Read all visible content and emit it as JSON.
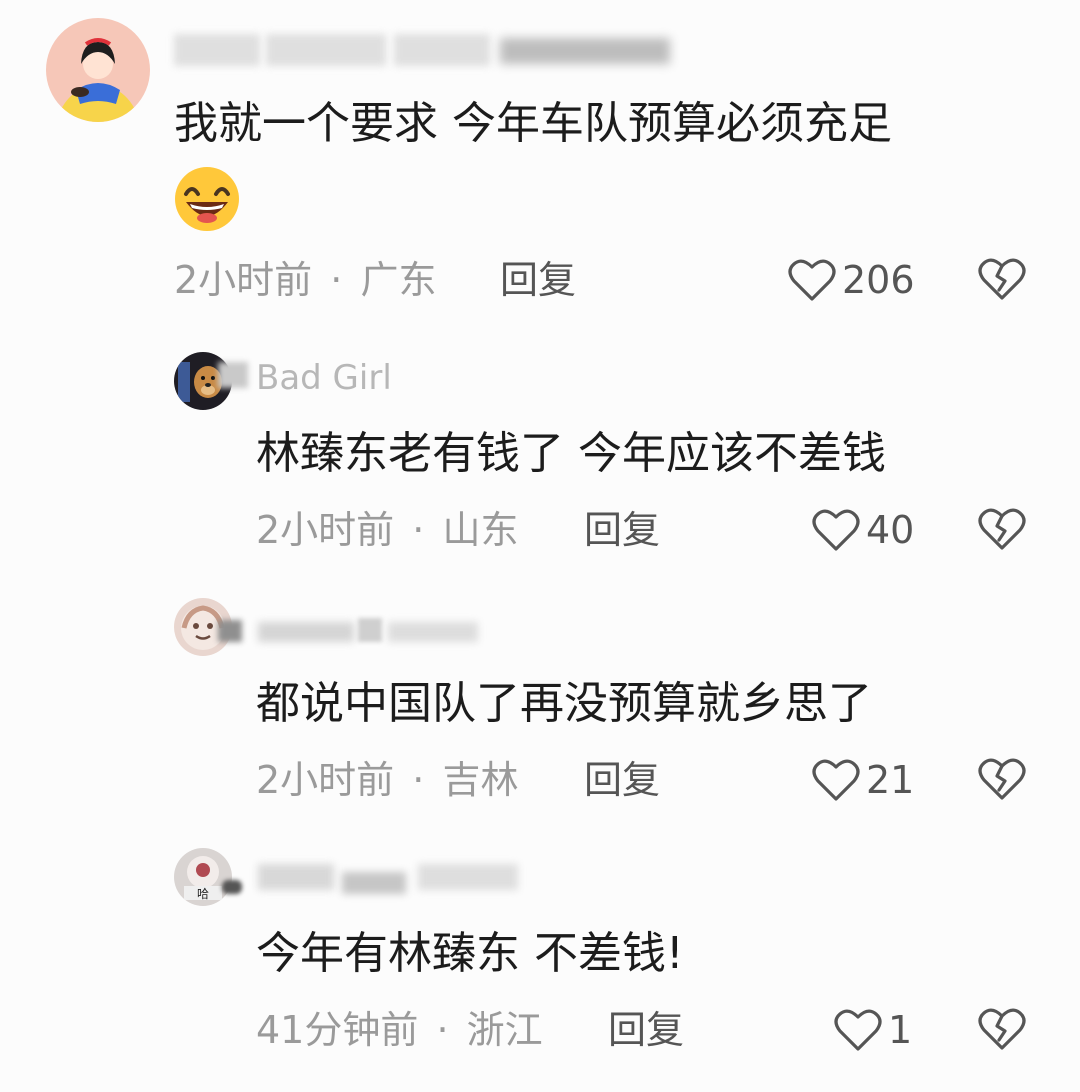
{
  "comments": [
    {
      "username": "",
      "text": "我就一个要求 今年车队预算必须充足",
      "emoji": "grinning-face",
      "time": "2小时前",
      "location": "广东",
      "reply_label": "回复",
      "likes": "206"
    },
    {
      "username": "Bad  Girl",
      "text": "林臻东老有钱了  今年应该不差钱",
      "time": "2小时前",
      "location": "山东",
      "reply_label": "回复",
      "likes": "40"
    },
    {
      "username": "",
      "text": "都说中国队了再没预算就乡思了",
      "time": "2小时前",
      "location": "吉林",
      "reply_label": "回复",
      "likes": "21"
    },
    {
      "username": "",
      "text": "今年有林臻东 不差钱!",
      "time": "41分钟前",
      "location": "浙江",
      "reply_label": "回复",
      "likes": "1"
    }
  ],
  "separator": "·",
  "colors": {
    "background": "#fcfcfc",
    "text": "#1c1c1c",
    "meta": "#9a9a9a",
    "action": "#555555",
    "emoji_face": "#ffc83a"
  }
}
